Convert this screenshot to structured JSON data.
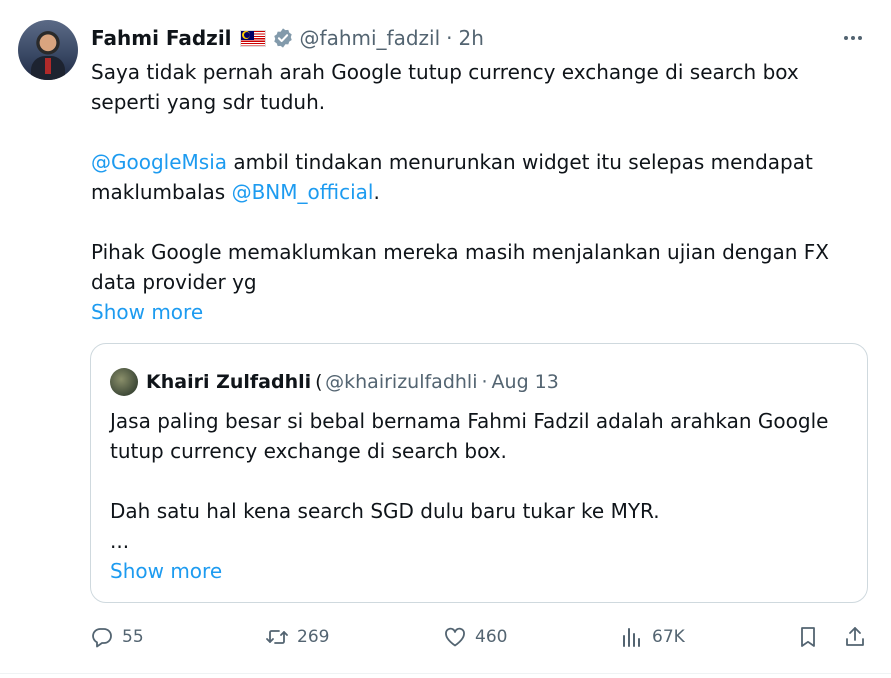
{
  "post": {
    "author_name": "Fahmi Fadzil",
    "flag_emoji": "malaysia-flag",
    "verified": true,
    "handle": "@fahmi_fadzil",
    "separator": "·",
    "time": "2h",
    "lines": {
      "p1": "Saya tidak pernah arah Google tutup currency exchange di search box seperti yang sdr tuduh.",
      "p2_mention1": "@GoogleMsia",
      "p2_text1": " ambil tindakan menurunkan widget itu selepas mendapat maklumbalas ",
      "p2_mention2": "@BNM_official",
      "p2_text2": ".",
      "p3": "Pihak Google memaklumkan mereka masih menjalankan ujian dengan FX data provider yg"
    },
    "show_more": "Show more"
  },
  "quote": {
    "author_name": "Khairi Zulfadhli",
    "handle": "@khairizulfadhli",
    "separator": "·",
    "date": "Aug 13",
    "p1": "Jasa paling besar si bebal bernama Fahmi Fadzil adalah arahkan Google tutup currency exchange di search box.",
    "p2": "Dah satu hal kena search SGD dulu baru tukar ke MYR.",
    "p3": "...",
    "show_more": "Show more"
  },
  "actions": {
    "replies": "55",
    "reposts": "269",
    "likes": "460",
    "views": "67K"
  },
  "colors": {
    "accent": "#1d9bf0",
    "text": "#0f1419",
    "muted": "#536471",
    "border": "#cfd9de",
    "verified": "#829aab"
  }
}
